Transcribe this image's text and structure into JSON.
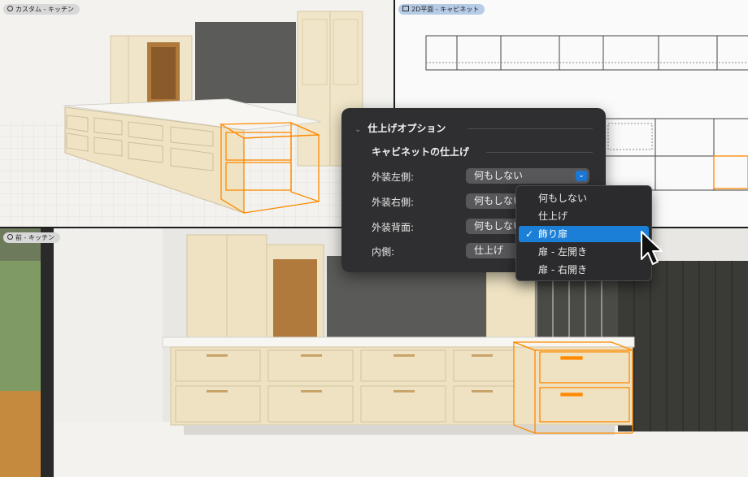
{
  "viewports": {
    "top_left": {
      "label": "カスタム - キッチン"
    },
    "top_right": {
      "label": "2D平面 - キャビネット"
    },
    "bottom": {
      "label": "前 - キッチン"
    }
  },
  "panel": {
    "title": "仕上げオプション",
    "section": "キャビネットの仕上げ",
    "rows": [
      {
        "label": "外装左側:",
        "value": "何もしない"
      },
      {
        "label": "外装右側:",
        "value": "何もしない"
      },
      {
        "label": "外装背面:",
        "value": "何もしない"
      },
      {
        "label": "内側:",
        "value": "仕上げ"
      }
    ]
  },
  "dropdown": {
    "options": [
      "何もしない",
      "仕上げ",
      "飾り扉",
      "扉 - 左開き",
      "扉 - 右開き"
    ],
    "selected_index": 2,
    "check_glyph": "✓"
  },
  "colors": {
    "accent": "#1b7fd8",
    "selection": "#ff8a00",
    "panel_bg": "#2f2f31",
    "cabinet": "#eee2c3"
  }
}
